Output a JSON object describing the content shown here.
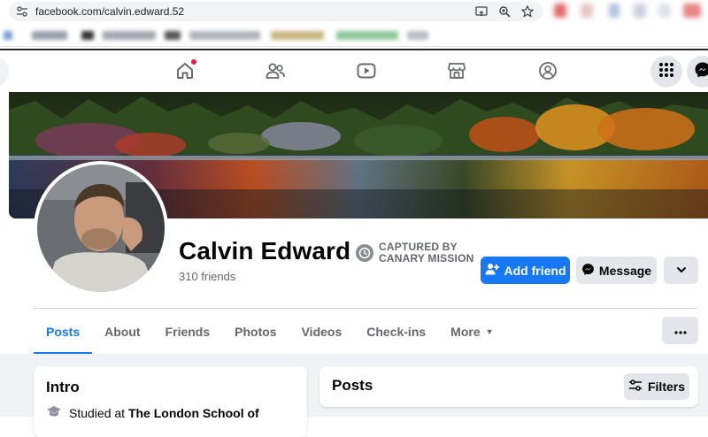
{
  "browser": {
    "url": "facebook.com/calvin.edward.52",
    "icons": [
      "site-settings-icon",
      "cast-icon",
      "zoom-icon",
      "bookmark-star-icon"
    ]
  },
  "fb_nav": {
    "icons": [
      "home-icon",
      "friends-icon",
      "watch-icon",
      "marketplace-icon",
      "groups-icon",
      "menu-grid-icon",
      "messenger-icon"
    ],
    "home_has_notification": true
  },
  "profile": {
    "name": "Calvin Edward",
    "friends": "310 friends",
    "badge": {
      "line1": "CAPTURED BY",
      "line2": "CANARY MISSION"
    }
  },
  "actions": {
    "add_friend": "Add friend",
    "message": "Message"
  },
  "tabs": [
    {
      "label": "Posts",
      "active": true
    },
    {
      "label": "About",
      "active": false
    },
    {
      "label": "Friends",
      "active": false
    },
    {
      "label": "Photos",
      "active": false
    },
    {
      "label": "Videos",
      "active": false
    },
    {
      "label": "Check-ins",
      "active": false
    },
    {
      "label": "More",
      "active": false
    }
  ],
  "intro": {
    "title": "Intro",
    "studied_prefix": "Studied at ",
    "school": "The London School of"
  },
  "posts": {
    "title": "Posts",
    "filters": "Filters"
  },
  "colors": {
    "accent": "#1877f2",
    "secondary_button": "#e4e6eb",
    "feed_background": "#f0f2f5",
    "notification": "#e41e3f"
  }
}
